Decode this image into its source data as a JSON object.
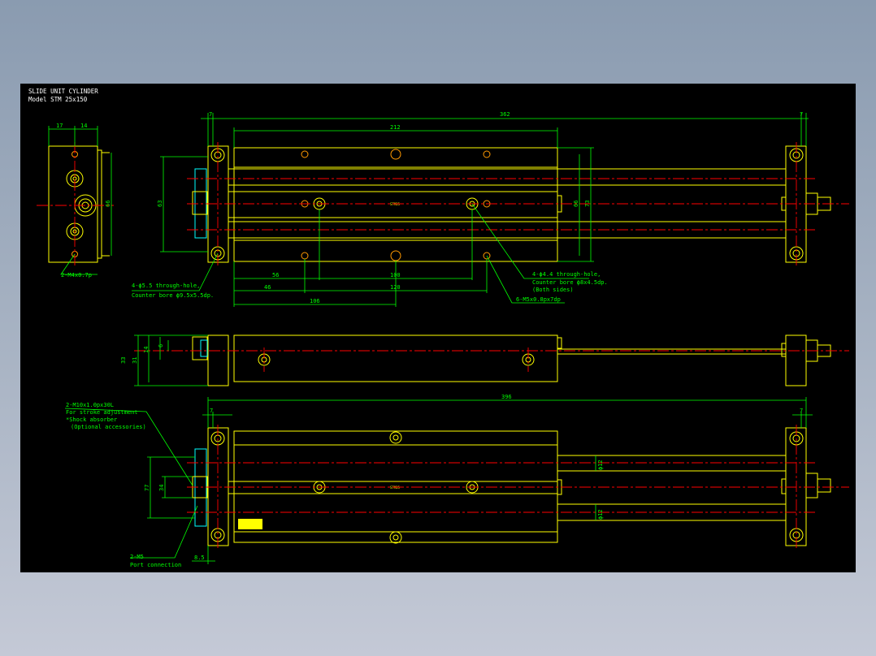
{
  "title_block": {
    "title": "SLIDE UNIT CYLINDER",
    "model": "Model  STM  25x150"
  },
  "colors": {
    "background": "#000000",
    "outline": "#ffff00",
    "dimension": "#00ff00",
    "centerline": "#ff0000",
    "thread": "#00ffff"
  },
  "dims": {
    "d17": "17",
    "d14": "14",
    "d66a": "66",
    "d7a": "7",
    "d362": "362",
    "d7b": "7",
    "d212": "212",
    "d63": "63",
    "d66b": "66",
    "d73": "73",
    "d56": "56",
    "d100": "100",
    "d46": "46",
    "d120": "120",
    "d106": "106",
    "d33": "33",
    "d31": "31",
    "d14b": "14",
    "d6": "6",
    "d396": "396",
    "d7c": "7",
    "d7d": "7",
    "d77": "77",
    "d34": "34",
    "d85": "8.5",
    "phi12a": "ϕ12",
    "phi12b": "ϕ12"
  },
  "notes": {
    "m4": "2-M4x0.7p",
    "hole55_1": "4-ϕ5.5 through-hole,",
    "hole55_2": "Counter bore ϕ9.5x5.5dp.",
    "hole44_1": "4-ϕ4.4 through-hole,",
    "hole44_2": "Counter bore ϕ8x4.5dp.",
    "hole44_3": "(Both sides)",
    "m5tap": "6-M5x0.8px7dp",
    "m10_1": "2-M10x1.0px30L",
    "m10_2": "For stroke adjustment",
    "m10_3": "*Shock absorber",
    "m10_4": "(Optional accessories)",
    "port_1": "2-M5",
    "port_2": "Port connection",
    "mark_a": "STM25",
    "mark_b": "STM25"
  }
}
